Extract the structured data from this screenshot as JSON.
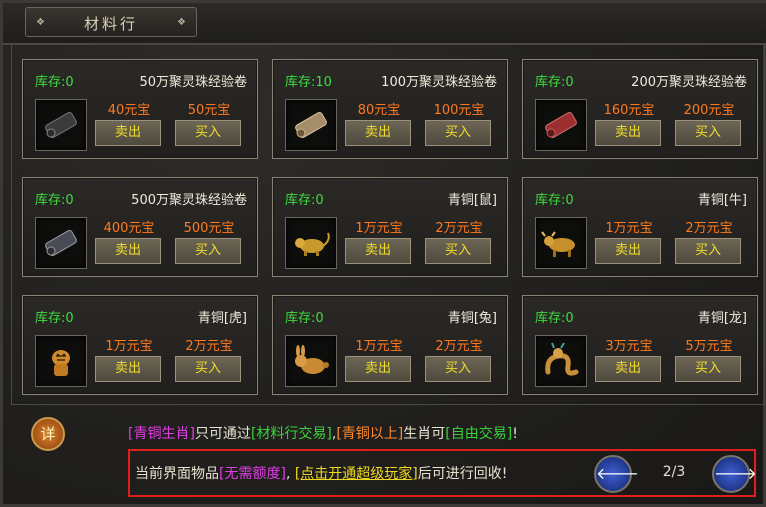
{
  "window": {
    "title": "材料行",
    "title_deco": "❖"
  },
  "items": [
    {
      "stock": "库存:0",
      "name": "50万聚灵珠经验卷",
      "sell_price": "40元宝",
      "buy_price": "50元宝",
      "sell_label": "卖出",
      "buy_label": "买入",
      "icon": "scroll-icon",
      "icon_color": "#3b3b3d"
    },
    {
      "stock": "库存:10",
      "name": "100万聚灵珠经验卷",
      "sell_price": "80元宝",
      "buy_price": "100元宝",
      "sell_label": "卖出",
      "buy_label": "买入",
      "icon": "scroll-icon",
      "icon_color": "#a58c6a"
    },
    {
      "stock": "库存:0",
      "name": "200万聚灵珠经验卷",
      "sell_price": "160元宝",
      "buy_price": "200元宝",
      "sell_label": "卖出",
      "buy_label": "买入",
      "icon": "scroll-icon",
      "icon_color": "#9c3030"
    },
    {
      "stock": "库存:0",
      "name": "500万聚灵珠经验卷",
      "sell_price": "400元宝",
      "buy_price": "500元宝",
      "sell_label": "卖出",
      "buy_label": "买入",
      "icon": "scroll-icon",
      "icon_color": "#4a4c55"
    },
    {
      "stock": "库存:0",
      "name": "青铜[鼠]",
      "sell_price": "1万元宝",
      "buy_price": "2万元宝",
      "sell_label": "卖出",
      "buy_label": "买入",
      "icon": "rat-figurine-icon",
      "icon_color": "#c89a2e"
    },
    {
      "stock": "库存:0",
      "name": "青铜[牛]",
      "sell_price": "1万元宝",
      "buy_price": "2万元宝",
      "sell_label": "卖出",
      "buy_label": "买入",
      "icon": "ox-figurine-icon",
      "icon_color": "#c8902a"
    },
    {
      "stock": "库存:0",
      "name": "青铜[虎]",
      "sell_price": "1万元宝",
      "buy_price": "2万元宝",
      "sell_label": "卖出",
      "buy_label": "买入",
      "icon": "tiger-figurine-icon",
      "icon_color": "#d08a2a"
    },
    {
      "stock": "库存:0",
      "name": "青铜[兔]",
      "sell_price": "1万元宝",
      "buy_price": "2万元宝",
      "sell_label": "卖出",
      "buy_label": "买入",
      "icon": "rabbit-figurine-icon",
      "icon_color": "#c88a34"
    },
    {
      "stock": "库存:0",
      "name": "青铜[龙]",
      "sell_price": "3万元宝",
      "buy_price": "5万元宝",
      "sell_label": "卖出",
      "buy_label": "买入",
      "icon": "dragon-figurine-icon",
      "icon_color": "#c8903a"
    }
  ],
  "info": {
    "badge": "详",
    "line1": {
      "t1": "[青铜生肖]",
      "t2": "只可通过",
      "t3": "[材料行交易]",
      "t4": ",",
      "t5": "[青铜以上]",
      "t6": "生肖可",
      "t7": "[自由交易]",
      "t8": "!"
    },
    "line2": {
      "t1": "当前界面物品",
      "t2": "[无需额度]",
      "t3": ", ",
      "t4": "[点击开通超级玩家]",
      "t5": "后可进行回收!"
    }
  },
  "pager": {
    "current_page": 2,
    "total_pages": 3,
    "label": "2/3",
    "prev_arrow": "🡐",
    "next_arrow": "🡒"
  },
  "colors": {
    "stock": "#3ddd3d",
    "price": "#ff7a1f",
    "button_text": "#f2de2a",
    "highlight_box": "#e01e1e"
  }
}
